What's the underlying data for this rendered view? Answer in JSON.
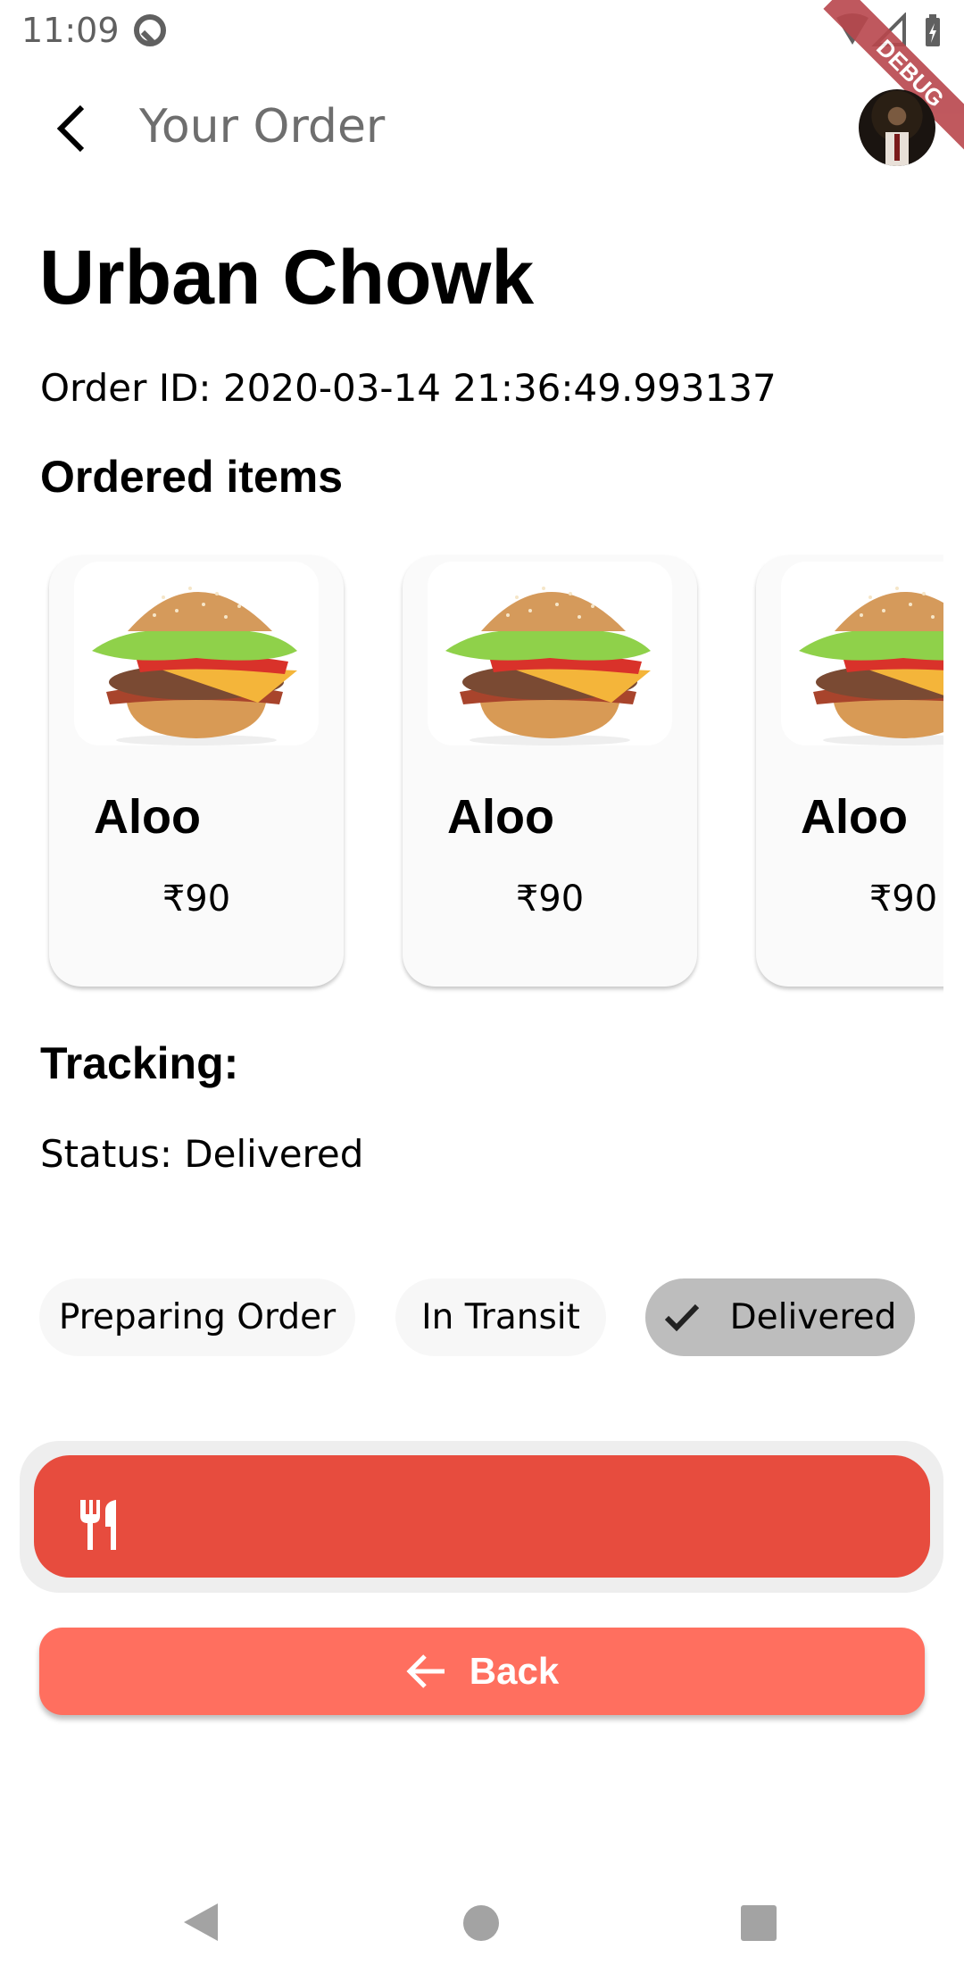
{
  "status_bar": {
    "time": "11:09",
    "icons": [
      "at-sign-icon",
      "wifi-icon",
      "signal-icon",
      "battery-charging-icon"
    ]
  },
  "app_bar": {
    "title": "Your Order",
    "back_icon": "arrow-back-ios-icon",
    "avatar": "user-avatar",
    "debug_banner": "DEBUG"
  },
  "restaurant": "Urban Chowk",
  "order_id": "Order ID: 2020-03-14 21:36:49.993137",
  "ordered_items_heading": "Ordered items",
  "items": [
    {
      "name": "Aloo",
      "price": "₹90",
      "image": "burger-image"
    },
    {
      "name": "Aloo",
      "price": "₹90",
      "image": "burger-image"
    },
    {
      "name": "Aloo",
      "price": "₹90",
      "image": "burger-image"
    }
  ],
  "tracking": {
    "heading": "Tracking:",
    "status": "Status: Delivered",
    "steps": [
      {
        "label": "Preparing Order",
        "selected": false
      },
      {
        "label": "In Transit",
        "selected": false
      },
      {
        "label": "Delivered",
        "selected": true
      }
    ],
    "progress_icon": "restaurant-icon",
    "progress_color": "#e74c3e"
  },
  "back_button": {
    "label": "Back",
    "icon": "arrow-back-icon",
    "color": "#ff6f5f"
  },
  "nav_bar": {
    "icons": [
      "nav-back-icon",
      "nav-home-icon",
      "nav-recents-icon"
    ]
  }
}
